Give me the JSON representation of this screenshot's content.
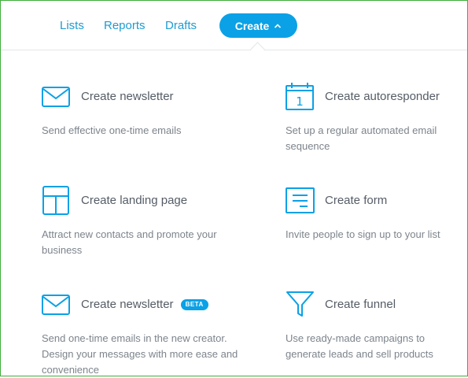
{
  "nav": {
    "lists": "Lists",
    "reports": "Reports",
    "drafts": "Drafts",
    "create": "Create"
  },
  "menu": [
    {
      "icon": "envelope-icon",
      "title": "Create newsletter",
      "desc": "Send effective one-time emails"
    },
    {
      "icon": "calendar-icon",
      "calendar_day": "1",
      "title": "Create autoresponder",
      "desc": "Set up a regular automated email sequence"
    },
    {
      "icon": "layout-icon",
      "title": "Create landing page",
      "desc": "Attract new contacts and promote your business"
    },
    {
      "icon": "form-icon",
      "title": "Create form",
      "desc": "Invite people to sign up to your list"
    },
    {
      "icon": "envelope-icon",
      "title": "Create newsletter",
      "badge": "BETA",
      "desc": "Send one-time emails in the new creator. Design your messages with more ease and convenience"
    },
    {
      "icon": "funnel-icon",
      "title": "Create funnel",
      "desc": "Use ready-made campaigns to generate leads and sell products"
    }
  ],
  "colors": {
    "accent": "#0aa1e6",
    "link": "#1f9bd1",
    "frame": "#3fae3b",
    "title": "#555c66",
    "desc": "#7d848c"
  }
}
